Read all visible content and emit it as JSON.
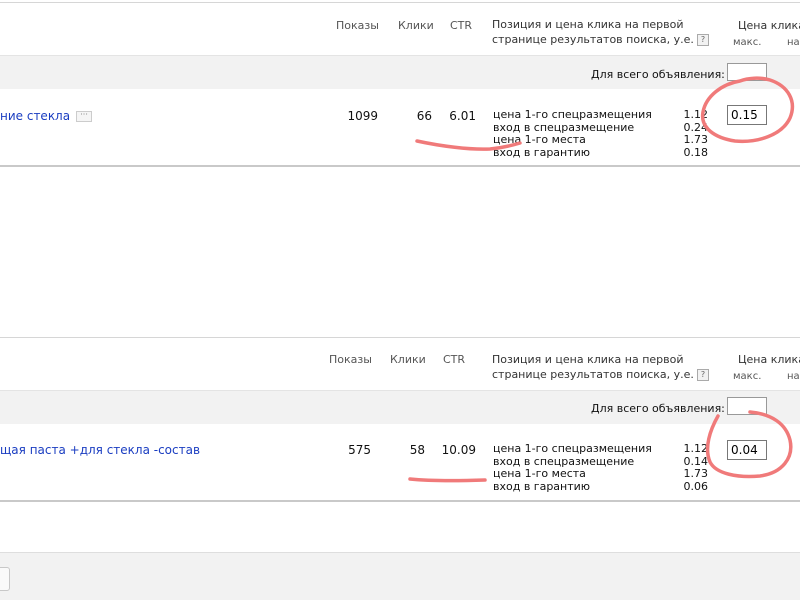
{
  "columns": {
    "impressions": "Показы",
    "clicks": "Клики",
    "ctr": "CTR",
    "position_line1": "Позиция и цена клика на первой",
    "position_line2": "страницe результатов поиска, у.е.",
    "help": "?",
    "price_header": "Цена клика",
    "max": "макс.",
    "on_cut": "на"
  },
  "all_ads_label": "Для всего объявления:",
  "more_glyph": "···",
  "position_labels": [
    "цена 1-го спецразмещения",
    "вход в спецразмещение",
    "цена 1-го места",
    "вход в гарантию"
  ],
  "groups": [
    {
      "phrase": "ние стекла",
      "impressions": "1099",
      "clicks": "66",
      "ctr": "6.01",
      "position_values": [
        "1.12",
        "0.24",
        "1.73",
        "0.18"
      ],
      "bid": "0.15",
      "all_bid": ""
    },
    {
      "phrase": "щая паста +для стекла -состав",
      "impressions": "575",
      "clicks": "58",
      "ctr": "10.09",
      "position_values": [
        "1.12",
        "0.14",
        "1.73",
        "0.06"
      ],
      "bid": "0.04",
      "all_bid": ""
    }
  ],
  "colors": {
    "link": "#1a3dc1",
    "annotation": "#f07a7a"
  }
}
